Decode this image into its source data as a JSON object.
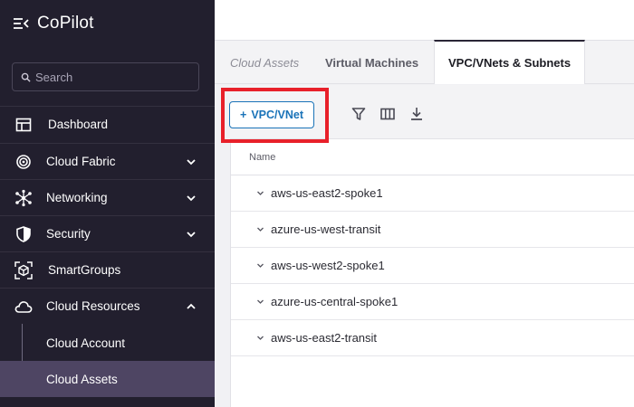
{
  "app": {
    "title": "CoPilot"
  },
  "search": {
    "placeholder": "Search"
  },
  "sidebar": {
    "items": [
      {
        "label": "Dashboard",
        "icon": "dashboard-icon",
        "chevron": "none"
      },
      {
        "label": "Cloud Fabric",
        "icon": "cloud-fabric-icon",
        "chevron": "down"
      },
      {
        "label": "Networking",
        "icon": "networking-icon",
        "chevron": "down"
      },
      {
        "label": "Security",
        "icon": "shield-icon",
        "chevron": "down"
      },
      {
        "label": "SmartGroups",
        "icon": "smartgroups-icon",
        "chevron": "none"
      },
      {
        "label": "Cloud Resources",
        "icon": "cloud-icon",
        "chevron": "up"
      }
    ],
    "subitems": [
      {
        "label": "Cloud Account",
        "active": false
      },
      {
        "label": "Cloud Assets",
        "active": true
      }
    ]
  },
  "tabs": [
    {
      "label": "Cloud Assets",
      "style": "breadcrumb"
    },
    {
      "label": "Virtual Machines",
      "style": "inactive"
    },
    {
      "label": "VPC/VNets & Subnets",
      "style": "active"
    }
  ],
  "toolbar": {
    "add_label": "VPC/VNet",
    "icons": [
      "filter-icon",
      "columns-icon",
      "download-icon"
    ]
  },
  "table": {
    "header": "Name",
    "rows": [
      "aws-us-east2-spoke1",
      "azure-us-west-transit",
      "aws-us-west2-spoke1",
      "azure-us-central-spoke1",
      "aws-us-east2-transit"
    ]
  },
  "colors": {
    "sidebar_bg": "#221f2e",
    "active_sub_bg": "#4e4563",
    "accent": "#1a73b8",
    "highlight": "#e8202a"
  }
}
